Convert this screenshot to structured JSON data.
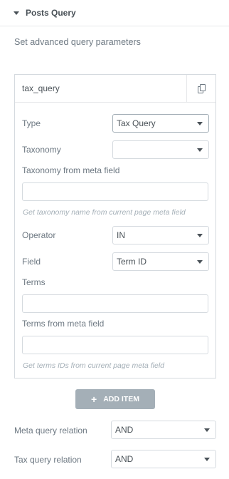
{
  "section": {
    "title": "Posts Query",
    "description": "Set advanced query parameters"
  },
  "repeater": {
    "item_title": "tax_query",
    "fields": {
      "type_label": "Type",
      "type_value": "Tax Query",
      "taxonomy_label": "Taxonomy",
      "taxonomy_value": "",
      "taxonomy_meta_label": "Taxonomy from meta field",
      "taxonomy_meta_value": "",
      "taxonomy_meta_hint": "Get taxonomy name from current page meta field",
      "operator_label": "Operator",
      "operator_value": "IN",
      "field_label": "Field",
      "field_value": "Term ID",
      "terms_label": "Terms",
      "terms_value": "",
      "terms_meta_label": "Terms from meta field",
      "terms_meta_value": "",
      "terms_meta_hint": "Get terms IDs from current page meta field"
    }
  },
  "add_item_label": "ADD ITEM",
  "meta_query_relation": {
    "label": "Meta query relation",
    "value": "AND"
  },
  "tax_query_relation": {
    "label": "Tax query relation",
    "value": "AND"
  },
  "icons": {
    "toggle": "caret-down-icon",
    "duplicate": "copy-icon",
    "add": "plus-icon",
    "dropdown": "chevron-down-icon"
  }
}
